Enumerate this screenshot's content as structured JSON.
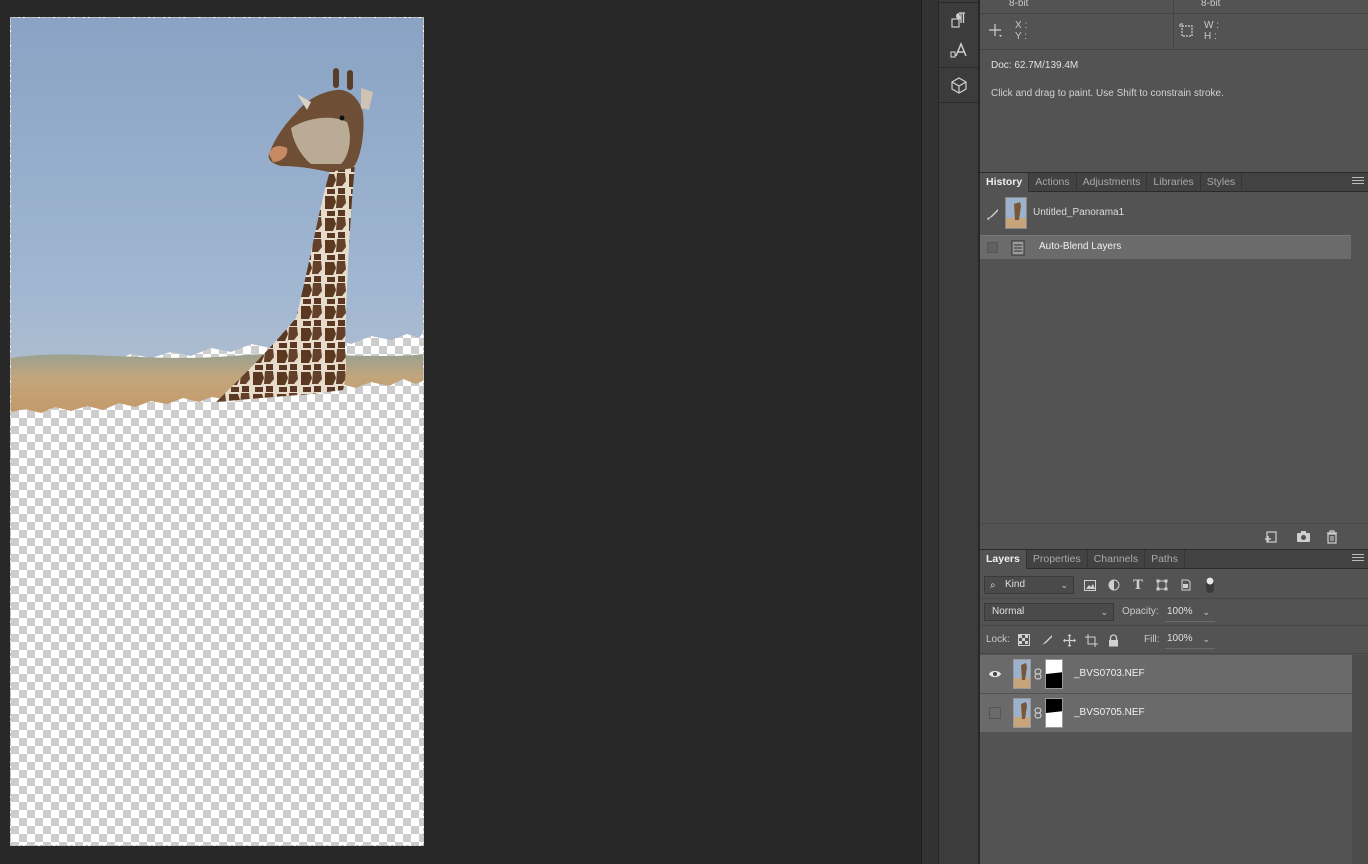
{
  "info": {
    "bits_left": "8-bit",
    "bits_right": "8-bit",
    "x_label": "X :",
    "y_label": "Y :",
    "w_label": "W :",
    "h_label": "H :",
    "doc": "Doc: 62.7M/139.4M",
    "hint": "Click and drag to paint. Use Shift to constrain stroke."
  },
  "history_tabs": [
    "History",
    "Actions",
    "Adjustments",
    "Libraries",
    "Styles"
  ],
  "history": {
    "snapshot": "Untitled_Panorama1",
    "steps": [
      "Auto-Blend Layers"
    ]
  },
  "layers_tabs": [
    "Layers",
    "Properties",
    "Channels",
    "Paths"
  ],
  "layers_panel": {
    "kind": "Kind",
    "blend_mode": "Normal",
    "opacity_label": "Opacity:",
    "opacity": "100%",
    "lock_label": "Lock:",
    "fill_label": "Fill:",
    "fill": "100%",
    "layers": [
      {
        "name": "_BVS0703.NEF",
        "visible": true
      },
      {
        "name": "_BVS0705.NEF",
        "visible": false
      }
    ]
  },
  "icons": {
    "tool_1": "paragraph-icon",
    "tool_2": "character-icon",
    "tool_3": "3d-cube-icon",
    "crosshair": "crosshair-icon",
    "selection": "selection-size-icon",
    "history_new_doc": "new-document-from-state-icon",
    "history_snapshot": "camera-icon",
    "history_delete": "trash-icon"
  }
}
